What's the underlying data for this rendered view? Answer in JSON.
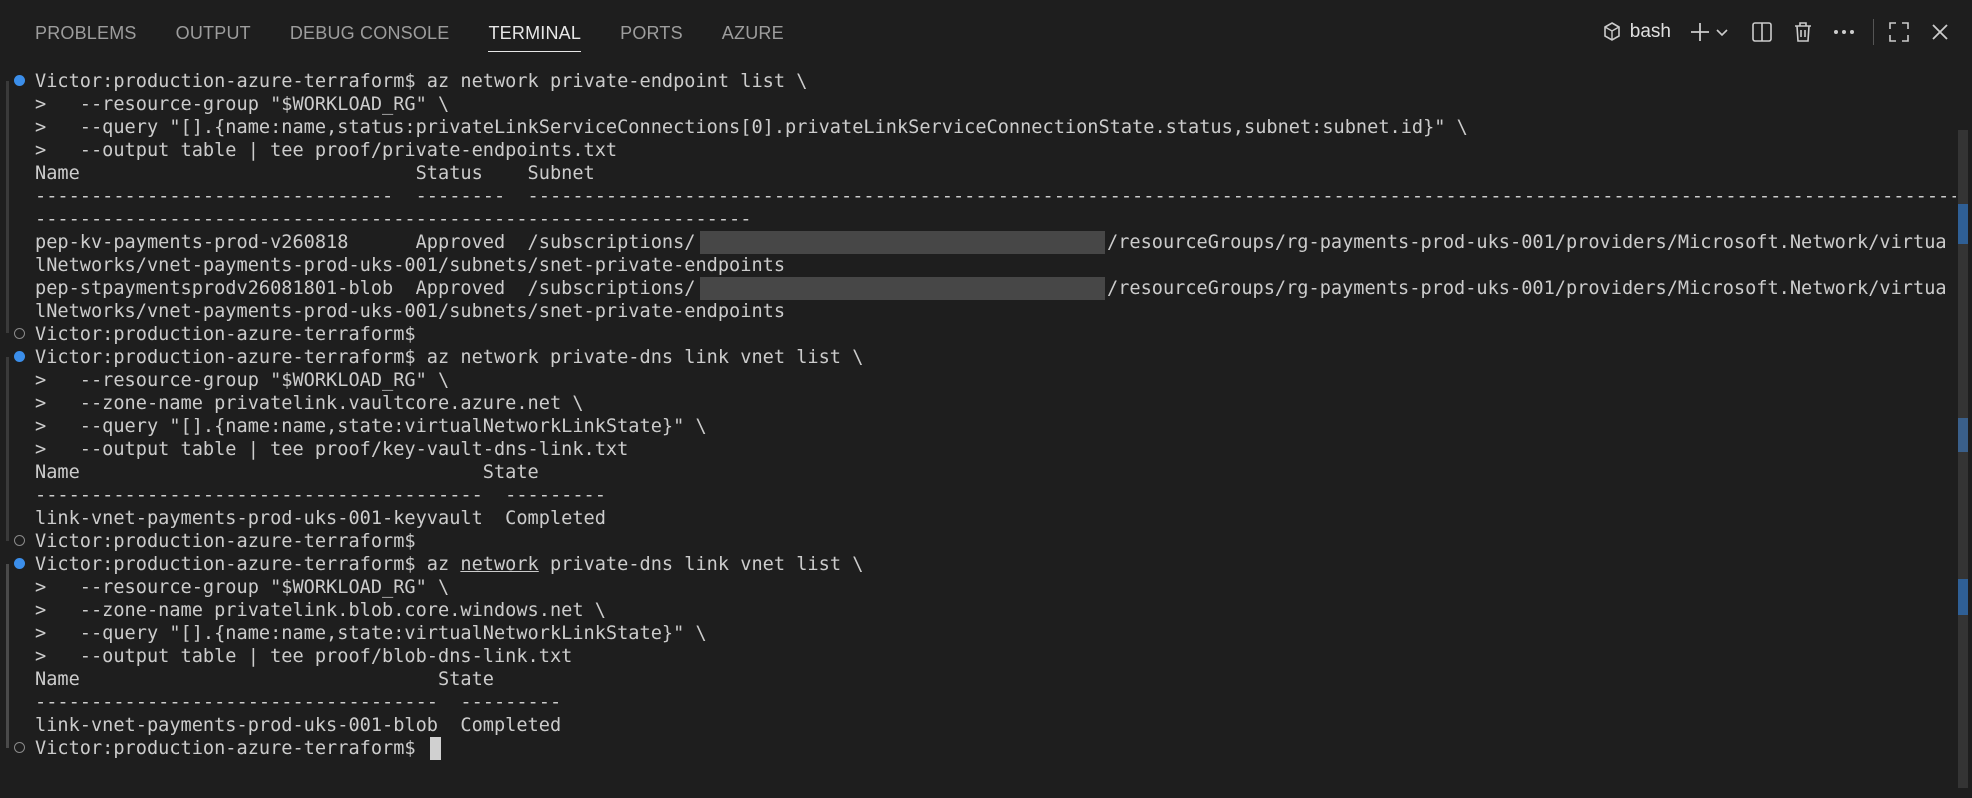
{
  "panel": {
    "tabs": [
      {
        "label": "PROBLEMS",
        "active": false
      },
      {
        "label": "OUTPUT",
        "active": false
      },
      {
        "label": "DEBUG CONSOLE",
        "active": false
      },
      {
        "label": "TERMINAL",
        "active": true
      },
      {
        "label": "PORTS",
        "active": false
      },
      {
        "label": "AZURE",
        "active": false
      }
    ],
    "shell_label": "bash",
    "action_icons": [
      "terminal-icon",
      "plus-icon",
      "chevron-down-icon",
      "split-icon",
      "trash-icon",
      "ellipsis-icon",
      "maximize-icon",
      "close-icon"
    ]
  },
  "terminal": {
    "prompt": "Victor:production-azure-terraform$",
    "lines": {
      "l0": " az network private-endpoint list \\",
      "l1": ">   --resource-group \"$WORKLOAD_RG\" \\",
      "l2": ">   --query \"[].{name:name,status:privateLinkServiceConnections[0].privateLinkServiceConnectionState.status,subnet:subnet.id}\" \\",
      "l3": ">   --output table | tee proof/private-endpoints.txt",
      "l4": "Name                              Status    Subnet",
      "l5": "--------------------------------  --------  ------------------------------------------------------------------------------------------------------------------------------------",
      "l6": "----------------------------------------------------------------",
      "l7a": "pep-kv-payments-prod-v260818      Approved  /subscriptions/",
      "l7b": "/resourceGroups/rg-payments-prod-uks-001/providers/Microsoft.Network/virtua",
      "l8": "lNetworks/vnet-payments-prod-uks-001/subnets/snet-private-endpoints",
      "l9a": "pep-stpaymentsprodv26081801-blob  Approved  /subscriptions/",
      "l9b": "/resourceGroups/rg-payments-prod-uks-001/providers/Microsoft.Network/virtua",
      "l10": "lNetworks/vnet-payments-prod-uks-001/subnets/snet-private-endpoints",
      "l12": " az network private-dns link vnet list \\",
      "l13": ">   --resource-group \"$WORKLOAD_RG\" \\",
      "l14": ">   --zone-name privatelink.vaultcore.azure.net \\",
      "l15": ">   --query \"[].{name:name,state:virtualNetworkLinkState}\" \\",
      "l16": ">   --output table | tee proof/key-vault-dns-link.txt",
      "l17": "Name                                    State",
      "l18": "----------------------------------------  ---------",
      "l19": "link-vnet-payments-prod-uks-001-keyvault  Completed",
      "l21a": " az ",
      "l21b": "network",
      "l21c": " private-dns link vnet list \\",
      "l22": ">   --resource-group \"$WORKLOAD_RG\" \\",
      "l23": ">   --zone-name privatelink.blob.core.windows.net \\",
      "l24": ">   --query \"[].{name:name,state:virtualNetworkLinkState}\" \\",
      "l25": ">   --output table | tee proof/blob-dns-link.txt",
      "l26": "Name                                State",
      "l27": "------------------------------------  ---------",
      "l28": "link-vnet-payments-prod-uks-001-blob  Completed"
    }
  }
}
